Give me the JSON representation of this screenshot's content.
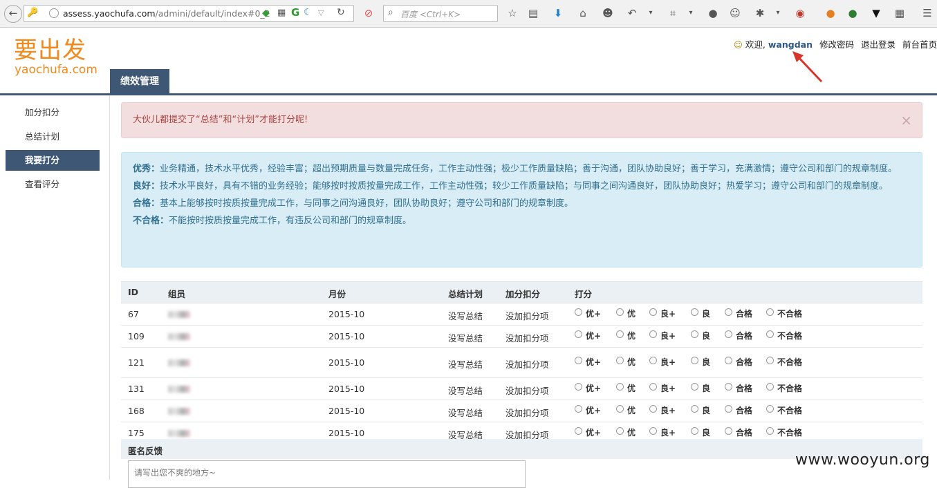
{
  "browser": {
    "url_domain": "assess.yaochufa.com",
    "url_path": "/admini/default/index#0_2",
    "search_placeholder": "百度 <Ctrl+K>"
  },
  "header": {
    "logo_cn": "要出发",
    "logo_en": "yaochufa.com",
    "main_tab": "绩效管理",
    "welcome": "欢迎,",
    "username": "wangdan",
    "links": [
      "修改密码",
      "退出登录",
      "前台首页"
    ]
  },
  "sidebar": {
    "items": [
      {
        "label": "加分扣分",
        "active": false
      },
      {
        "label": "总结计划",
        "active": false
      },
      {
        "label": "我要打分",
        "active": true
      },
      {
        "label": "查看评分",
        "active": false
      }
    ]
  },
  "alert": {
    "message": "大伙儿都提交了“总结”和“计划”才能打分呢!",
    "close": "×"
  },
  "criteria": [
    {
      "title": "优秀：",
      "text": "业务精通，技术水平优秀，经验丰富；超出预期质量与数量完成任务，工作主动性强；极少工作质量缺陷；善于沟通，团队协助良好；善于学习，充满激情；遵守公司和部门的规章制度。"
    },
    {
      "title": "良好：",
      "text": "技术水平良好，具有不错的业务经验；能够按时按质按量完成工作，工作主动性强；较少工作质量缺陷；与同事之间沟通良好，团队协助良好；热爱学习；遵守公司和部门的规章制度。"
    },
    {
      "title": "合格：",
      "text": "基本上能够按时按质按量完成工作，与同事之间沟通良好，团队协助良好；遵守公司和部门的规章制度。"
    },
    {
      "title": "不合格：",
      "text": "不能按时按质按量完成工作，有违反公司和部门的规章制度。"
    }
  ],
  "table": {
    "headers": [
      "ID",
      "组员",
      "月份",
      "总结计划",
      "加分扣分",
      "打分"
    ],
    "rating_options": [
      "优+",
      "优",
      "良+",
      "良",
      "合格",
      "不合格"
    ],
    "rows": [
      {
        "id": "67",
        "month": "2015-10",
        "summary": "没写总结",
        "bonus": "没加扣分项"
      },
      {
        "id": "109",
        "month": "2015-10",
        "summary": "没写总结",
        "bonus": "没加扣分项"
      },
      {
        "id": "121",
        "month": "2015-10",
        "summary": "没写总结",
        "bonus": "没加扣分项"
      },
      {
        "id": "131",
        "month": "2015-10",
        "summary": "没写总结",
        "bonus": "没加扣分项"
      },
      {
        "id": "168",
        "month": "2015-10",
        "summary": "没写总结",
        "bonus": "没加扣分项"
      },
      {
        "id": "175",
        "month": "2015-10",
        "summary": "没写总结",
        "bonus": "没加扣分项"
      }
    ]
  },
  "feedback": {
    "label": "匿名反馈",
    "placeholder": "请写出您不爽的地方~"
  },
  "watermark": "www.wooyun.org"
}
